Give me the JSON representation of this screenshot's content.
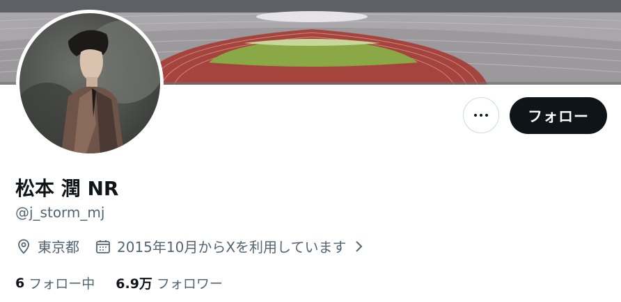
{
  "profile": {
    "display_name": "松本 潤 NR",
    "handle": "@j_storm_mj",
    "location": "東京都",
    "joined": "2015年10月からXを利用しています"
  },
  "actions": {
    "more_label": "",
    "follow_label": "フォロー"
  },
  "stats": {
    "following_count": "6",
    "following_label": "フォロー中",
    "followers_count": "6.9万",
    "followers_label": "フォロワー"
  },
  "colors": {
    "primary_text": "#0f1419",
    "secondary_text": "#536471",
    "follow_button_bg": "#0f1419",
    "border": "#cfd9de",
    "track": "#a5433d",
    "field": "#8aa845"
  },
  "icons": {
    "more": "more-horizontal-icon",
    "location": "location-pin-icon",
    "calendar": "calendar-icon",
    "chevron": "chevron-right-icon"
  }
}
